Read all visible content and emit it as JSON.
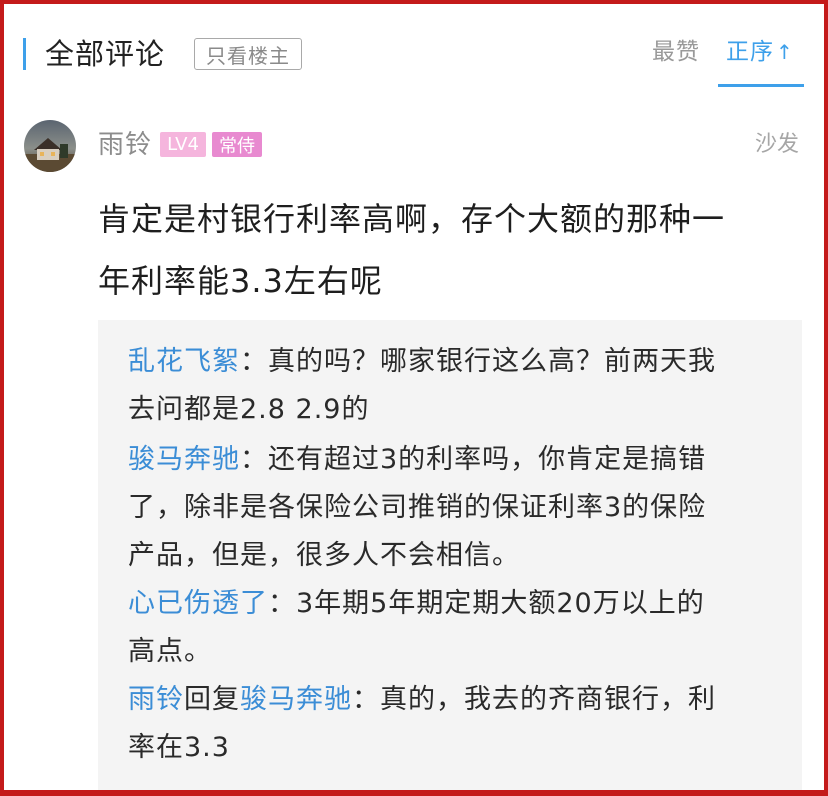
{
  "header": {
    "section_title": "全部评论",
    "owner_only_label": "只看楼主",
    "sort_hot_label": "最赞",
    "sort_asc_label": "正序",
    "sort_asc_arrow": "↑",
    "accent_color": "#3ea0ea"
  },
  "comment": {
    "avatar": "house-landscape-avatar",
    "username": "雨铃",
    "level_badge": "LV4",
    "title_badge": "常侍",
    "floor_label": "沙发",
    "body_line1": "肯定是村银行利率高啊，存个大额的那种一",
    "body_line2": "年利率能3.3左右呢"
  },
  "replies": [
    {
      "author": "乱花飞絮",
      "sep": "：",
      "line1": "真的吗？哪家银行这么高？前两天我",
      "line2": "去问都是2.8 2.9的"
    },
    {
      "author": "骏马奔驰",
      "sep": "：",
      "line1": "还有超过3的利率吗，你肯定是搞错",
      "line2": "了，除非是各保险公司推销的保证利率3的保险",
      "line3": "产品，但是，很多人不会相信。"
    },
    {
      "author": "心已伤透了",
      "sep": "：",
      "line1": "3年期5年期定期大额20万以上的",
      "line2": "高点。"
    },
    {
      "author": "雨铃",
      "reply_word": "回复",
      "target": "骏马奔驰",
      "sep": "：",
      "line1": "真的，我去的齐商银行，利",
      "line2": "率在3.3"
    }
  ],
  "colors": {
    "link_name": "#3b8dd6",
    "level_badge_bg": "#f5b5dd",
    "title_badge_bg": "#e88ad0",
    "frame_border": "#c41a1a"
  }
}
